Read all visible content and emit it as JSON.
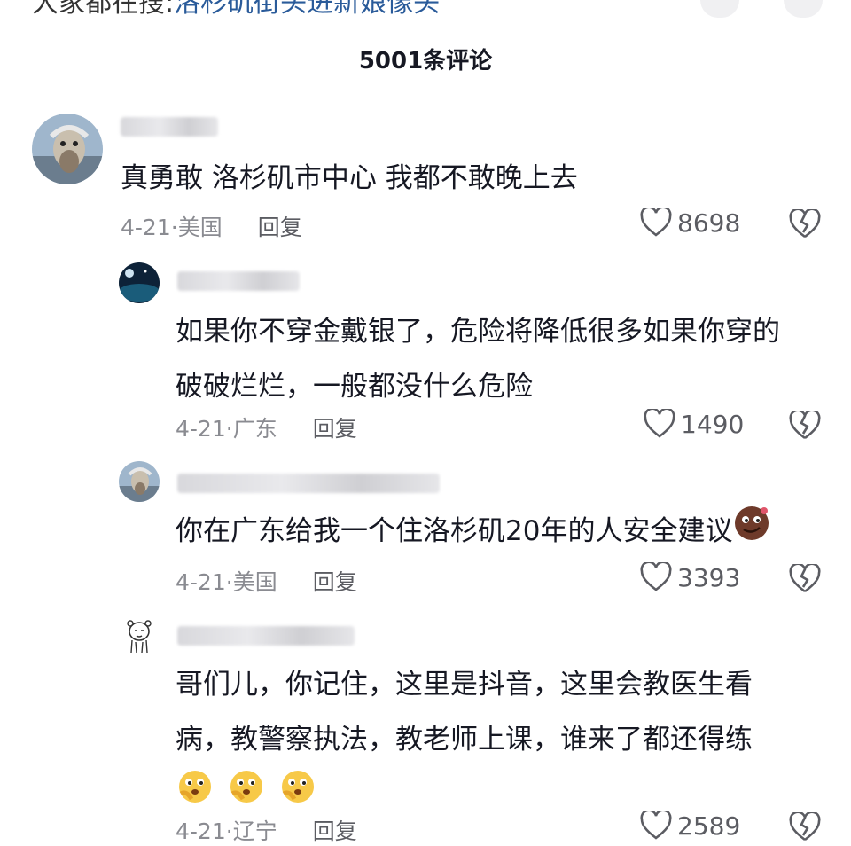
{
  "header": {
    "search_prefix": "大家都在搜:",
    "search_link": "洛杉矶街头进新娘像头",
    "title": "5001条评论"
  },
  "comments": [
    {
      "text_lines": [
        "真勇敢 洛杉矶市中心 我都不敢晚上去"
      ],
      "date": "4-21",
      "location": "美国",
      "reply_label": "回复",
      "likes": "8698"
    },
    {
      "text_lines": [
        "如果你不穿金戴银了，危险将降低很多如果你穿的",
        "破破烂烂，一般都没什么危险"
      ],
      "date": "4-21",
      "location": "广东",
      "reply_label": "回复",
      "likes": "1490"
    },
    {
      "text_lines": [
        "你在广东给我一个住洛杉矶20年的人安全建议"
      ],
      "date": "4-21",
      "location": "美国",
      "reply_label": "回复",
      "likes": "3393"
    },
    {
      "text_lines": [
        "哥们儿，你记住，这里是抖音，这里会教医生看",
        "病，教警察执法，教老师上课，谁来了都还得练"
      ],
      "date": "4-21",
      "location": "辽宁",
      "reply_label": "回复",
      "likes": "2589"
    }
  ],
  "icons": {
    "like": "heart-outline-icon",
    "dislike": "broken-heart-icon",
    "emoji_face": "smirk-emoji",
    "emoji_think": "thinking-emoji"
  },
  "colors": {
    "text": "#161823",
    "meta": "#8a8b91",
    "link": "#2a5b9a"
  }
}
